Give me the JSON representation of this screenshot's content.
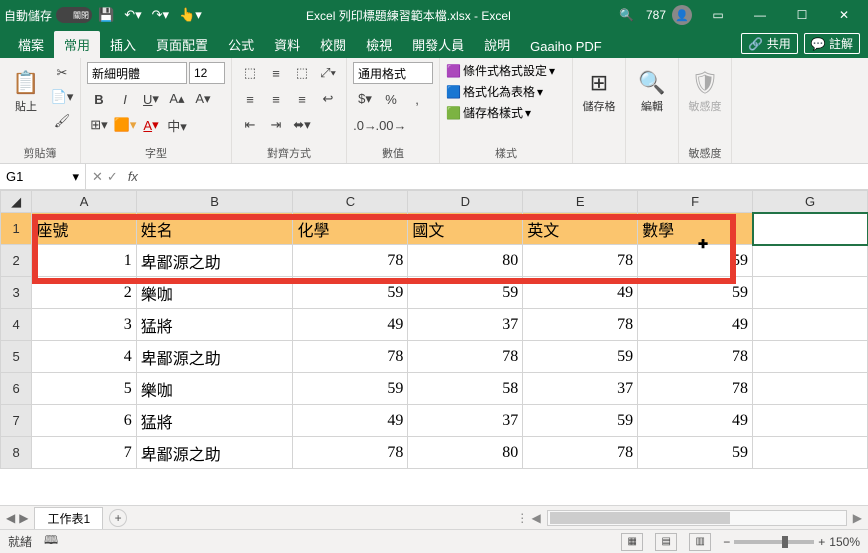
{
  "titlebar": {
    "autosave": "自動儲存",
    "toggle": "關閉",
    "filename": "Excel 列印標題練習範本檔.xlsx - Excel",
    "user_num": "787"
  },
  "tabs": {
    "file": "檔案",
    "home": "常用",
    "insert": "插入",
    "layout": "頁面配置",
    "formulas": "公式",
    "data": "資料",
    "review": "校閱",
    "view": "檢視",
    "developer": "開發人員",
    "help": "說明",
    "gaaiho": "Gaaiho PDF",
    "share": "共用",
    "comments": "註解"
  },
  "ribbon": {
    "clipboard": {
      "paste": "貼上",
      "label": "剪貼簿"
    },
    "font": {
      "name": "新細明體",
      "size": "12",
      "label": "字型"
    },
    "align": {
      "label": "對齊方式"
    },
    "number": {
      "format": "通用格式",
      "label": "數值"
    },
    "styles": {
      "cond": "條件式格式設定",
      "table": "格式化為表格",
      "cell": "儲存格樣式",
      "label": "樣式"
    },
    "cells": {
      "label": "儲存格"
    },
    "editing": {
      "label": "編輯"
    },
    "sens": {
      "btn": "敏感度",
      "label": "敏感度"
    }
  },
  "namebox": "G1",
  "colheaders": [
    "A",
    "B",
    "C",
    "D",
    "E",
    "F",
    "G"
  ],
  "rowheaders": [
    "1",
    "2",
    "3",
    "4",
    "5",
    "6",
    "7",
    "8"
  ],
  "header_row": [
    "座號",
    "姓名",
    "化學",
    "國文",
    "英文",
    "數學"
  ],
  "rows": [
    {
      "no": 1,
      "name": "卑鄙源之助",
      "chem": 78,
      "chi": 80,
      "eng": 78,
      "math": 59
    },
    {
      "no": 2,
      "name": "樂咖",
      "chem": 59,
      "chi": 59,
      "eng": 49,
      "math": 59
    },
    {
      "no": 3,
      "name": "猛將",
      "chem": 49,
      "chi": 37,
      "eng": 78,
      "math": 49
    },
    {
      "no": 4,
      "name": "卑鄙源之助",
      "chem": 78,
      "chi": 78,
      "eng": 59,
      "math": 78
    },
    {
      "no": 5,
      "name": "樂咖",
      "chem": 59,
      "chi": 58,
      "eng": 37,
      "math": 78
    },
    {
      "no": 6,
      "name": "猛將",
      "chem": 49,
      "chi": 37,
      "eng": 59,
      "math": 49
    },
    {
      "no": 7,
      "name": "卑鄙源之助",
      "chem": 78,
      "chi": 80,
      "eng": 78,
      "math": 59
    }
  ],
  "sheet": {
    "tab1": "工作表1"
  },
  "status": {
    "ready": "就緒",
    "zoom": "150%"
  }
}
